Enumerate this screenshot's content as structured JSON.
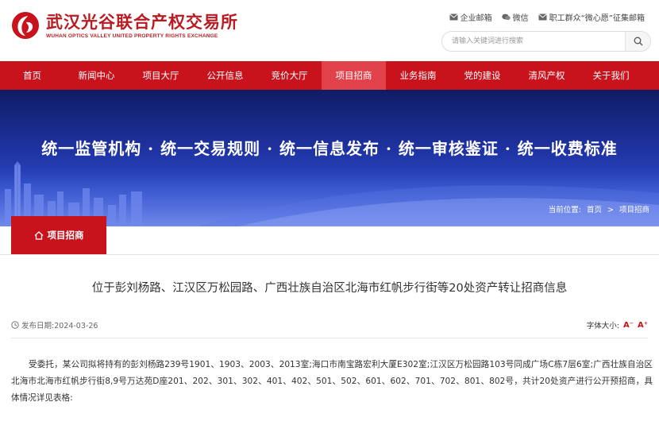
{
  "header": {
    "logo_cn": "武汉光谷联合产权交易所",
    "logo_en": "WUHAN OPTICS VALLEY UNITED PROPERTY RIGHTS EXCHANGE",
    "links": [
      "企业邮箱",
      "微信",
      "职工群众“微心愿”征集邮箱"
    ],
    "search_placeholder": "请输入关键词进行搜索"
  },
  "nav": {
    "items": [
      "首页",
      "新闻中心",
      "项目大厅",
      "公开信息",
      "竞价大厅",
      "项目招商",
      "业务指南",
      "党的建设",
      "清风产权",
      "关于我们"
    ],
    "active_index": 5
  },
  "banner": {
    "slogan": "统一监管机构 · 统一交易规则 · 统一信息发布 · 统一审核鉴证 · 统一收费标准",
    "breadcrumb_label": "当前位置:",
    "breadcrumb_home": "首页",
    "breadcrumb_sep": ">",
    "breadcrumb_current": "项目招商"
  },
  "section": {
    "title": "项目招商"
  },
  "article": {
    "title": "位于彭刘杨路、江汉区万松园路、广西壮族自治区北海市红帆步行街等20处资产转让招商信息",
    "date": "发布日期:2024-03-26",
    "font_size_label": "字体大小:",
    "font_smaller": "A⁻",
    "font_larger": "A⁺",
    "body": "受委托，某公司拟将持有的彭刘杨路239号1901、1903、2003、2013室;海口市南宝路宏利大厦E302室;江汉区万松园路103号同成广场C栋7层6室;广西壮族自治区北海市北海市红帆步行街8,9号万达苑D座201、202、301、302、401、402、501、502、601、602、701、702、801、802号，共计20处资产进行公开预招商，具体情况详见表格:"
  },
  "colors": {
    "brand_red": "#c8121c",
    "nav_active": "#e1414a",
    "banner_blue": "#1f33a3"
  }
}
